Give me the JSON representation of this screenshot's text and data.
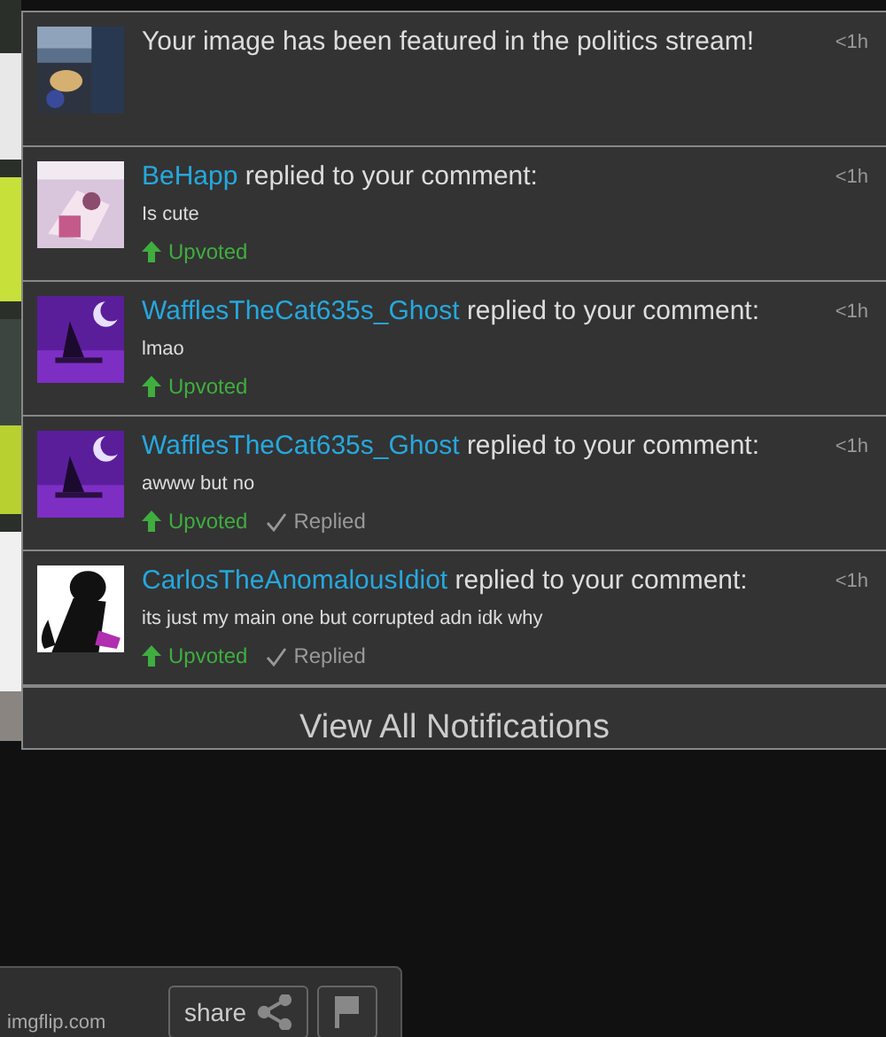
{
  "notifications": [
    {
      "kind": "featured",
      "message": "Your image has been featured in the politics stream!",
      "time": "<1h"
    },
    {
      "kind": "reply",
      "user": "BeHapp",
      "action": "replied to your comment:",
      "comment": "Is cute",
      "time": "<1h",
      "statuses": [
        {
          "kind": "upvoted",
          "label": "Upvoted"
        }
      ]
    },
    {
      "kind": "reply",
      "user": "WafflesTheCat635s_Ghost",
      "action": "replied to your comment:",
      "comment": "lmao",
      "time": "<1h",
      "statuses": [
        {
          "kind": "upvoted",
          "label": "Upvoted"
        }
      ]
    },
    {
      "kind": "reply",
      "user": "WafflesTheCat635s_Ghost",
      "action": "replied to your comment:",
      "comment": "awww but no",
      "time": "<1h",
      "statuses": [
        {
          "kind": "upvoted",
          "label": "Upvoted"
        },
        {
          "kind": "replied",
          "label": "Replied"
        }
      ]
    },
    {
      "kind": "reply",
      "user": "CarlosTheAnomalousIdiot",
      "action": "replied to your comment:",
      "comment": "its just my main one but corrupted adn idk why",
      "time": "<1h",
      "statuses": [
        {
          "kind": "upvoted",
          "label": "Upvoted"
        },
        {
          "kind": "replied",
          "label": "Replied"
        }
      ]
    }
  ],
  "view_all": "View All Notifications",
  "footer": {
    "site": "imgflip.com",
    "share": "share"
  }
}
